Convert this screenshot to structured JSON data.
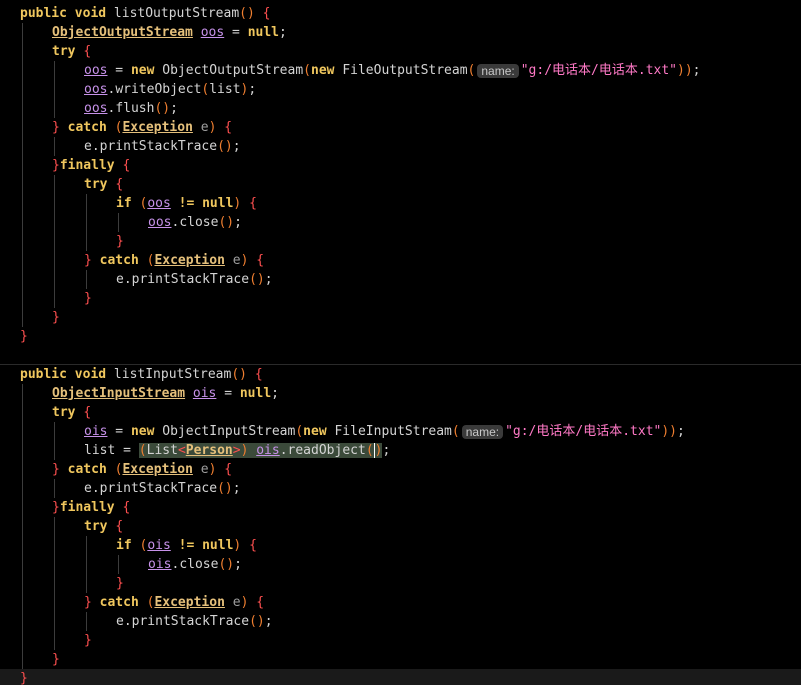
{
  "method1": {
    "sig_mod": "public void",
    "sig_name": "listOutputStream",
    "decl_type": "ObjectOutputStream",
    "var": "oos",
    "null_kw": "null",
    "try_kw": "try",
    "new_kw": "new",
    "stream_ctor": "ObjectOutputStream",
    "file_ctor": "FileOutputStream",
    "param_hint": "name:",
    "path": "\"g:/电话本/电话本.txt\"",
    "write_call": "writeObject",
    "write_arg": "list",
    "flush_call": "flush",
    "catch_kw": "catch",
    "exc_type": "Exception",
    "exc_var": "e",
    "print_call": "printStackTrace",
    "finally_kw": "finally",
    "if_kw": "if",
    "neq": "!=",
    "close_call": "close"
  },
  "method2": {
    "sig_mod": "public void",
    "sig_name": "listInputStream",
    "decl_type": "ObjectInputStream",
    "var": "ois",
    "null_kw": "null",
    "try_kw": "try",
    "new_kw": "new",
    "stream_ctor": "ObjectInputStream",
    "file_ctor": "FileInputStream",
    "param_hint": "name:",
    "path": "\"g:/电话本/电话本.txt\"",
    "list_var": "list",
    "cast_open": "(List<",
    "cast_type": "Person",
    "cast_close": ">)",
    "read_call": "readObject",
    "catch_kw": "catch",
    "exc_type": "Exception",
    "exc_var": "e",
    "print_call": "printStackTrace",
    "finally_kw": "finally",
    "if_kw": "if",
    "neq": "!=",
    "close_call": "close"
  },
  "colors": {
    "background": "#000000",
    "keyword": "#f0c75e",
    "brace": "#ff5050",
    "string": "#ff79c6",
    "field": "#c792ea"
  }
}
